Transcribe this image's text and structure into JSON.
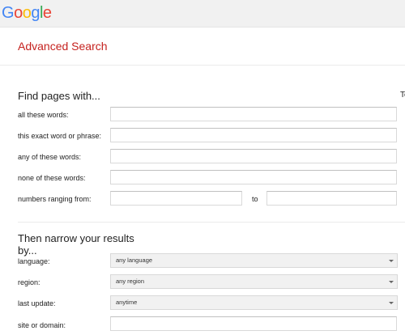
{
  "logo": {
    "letters": [
      "G",
      "o",
      "o",
      "g",
      "l",
      "e"
    ]
  },
  "page_title": "Advanced Search",
  "find_section": {
    "heading": "Find pages with...",
    "right_fragment": "To",
    "fields": {
      "all_words": {
        "label": "all these words:",
        "value": ""
      },
      "exact_phrase": {
        "label": "this exact word or phrase:",
        "value": ""
      },
      "any_words": {
        "label": "any of these words:",
        "value": ""
      },
      "none_words": {
        "label": "none of these words:",
        "value": ""
      },
      "numbers": {
        "label": "numbers ranging from:",
        "from_value": "",
        "to_label": "to",
        "to_value": ""
      }
    }
  },
  "narrow_section": {
    "heading_line1": "Then narrow your results",
    "heading_line2": "by...",
    "language": {
      "label": "language:",
      "selected": "any language"
    },
    "region": {
      "label": "region:",
      "selected": "any region"
    },
    "last_update": {
      "label": "last update:",
      "selected": "anytime"
    },
    "site": {
      "label": "site or domain:",
      "value": ""
    }
  },
  "colors": {
    "title": "#c5221f",
    "topbar": "#f1f1f1"
  }
}
